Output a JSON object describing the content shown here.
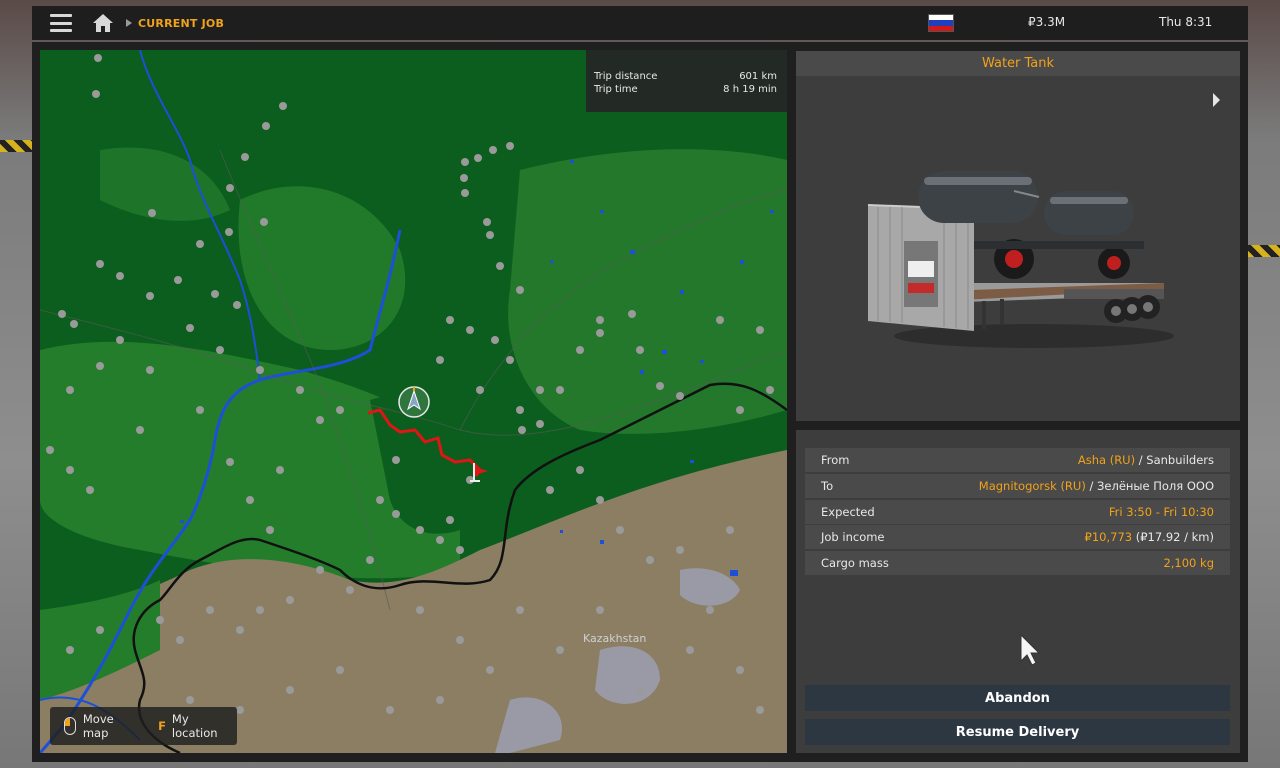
{
  "header": {
    "breadcrumb": "CURRENT JOB",
    "money": "₽3.3M",
    "clock": "Thu 8:31"
  },
  "trip": {
    "distance_label": "Trip distance",
    "distance_value": "601 km",
    "time_label": "Trip time",
    "time_value": "8 h 19 min"
  },
  "map": {
    "region_label": "Kazakhstan",
    "hint_move": "Move map",
    "hint_key": "F",
    "hint_location": "My location"
  },
  "cargo": {
    "title": "Water Tank"
  },
  "details": {
    "from_label": "From",
    "from_city": "Asha (RU)",
    "from_company": " / Sanbuilders",
    "to_label": "To",
    "to_city": "Magnitogorsk (RU)",
    "to_company": " / Зелёные Поля ООО",
    "expected_label": "Expected",
    "expected_value": "Fri 3:50 - Fri 10:30",
    "income_label": "Job income",
    "income_value": "₽10,773",
    "income_rate": " (₽17.92 / km)",
    "mass_label": "Cargo mass",
    "mass_value": "2,100 kg"
  },
  "actions": {
    "abandon": "Abandon",
    "resume": "Resume Delivery"
  },
  "colors": {
    "accent": "#f0a21b",
    "route": "#e01515",
    "forest": "#0b5e1d",
    "steppe": "#8b7e63",
    "water": "#1e4fd8"
  },
  "icons": [
    "menu-icon",
    "home-icon",
    "russia-flag-icon",
    "mouse-icon",
    "next-arrow-icon",
    "truck-position-icon",
    "destination-flag-icon",
    "cursor-icon"
  ]
}
